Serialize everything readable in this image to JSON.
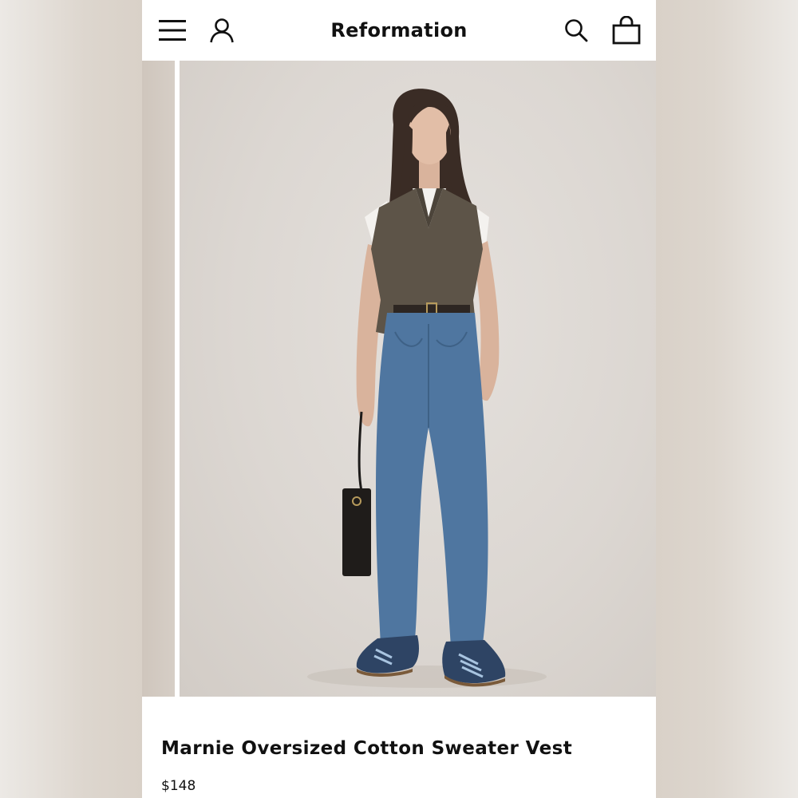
{
  "header": {
    "brand": "Reformation",
    "icons": {
      "menu": "hamburger-menu-icon",
      "account": "user-icon",
      "search": "search-icon",
      "bag": "shopping-bag-icon"
    }
  },
  "product": {
    "name": "Marnie Oversized Cotton Sweater Vest",
    "price": "$148"
  },
  "colors": {
    "text": "#111111",
    "background": "#ffffff",
    "photo_backdrop": "#dcd7d2",
    "vest": "#5d5448",
    "denim": "#4f76a0",
    "sneaker": "#2e4464"
  }
}
